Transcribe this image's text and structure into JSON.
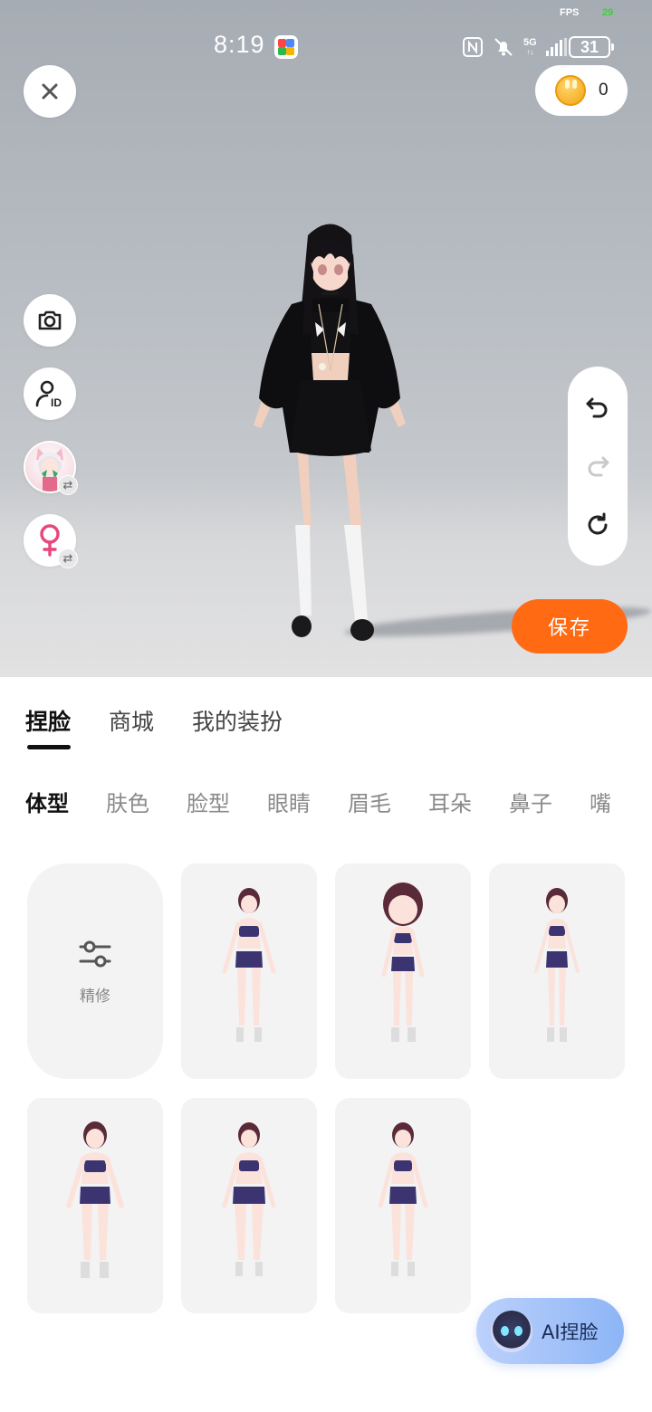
{
  "status_bar": {
    "time": "8:19",
    "fps_label": "FPS",
    "fps_value": "29",
    "network": "5G",
    "battery": "31"
  },
  "stage": {
    "coin_count": "0",
    "save_label": "保存",
    "icons": {
      "close": "close-icon",
      "coin": "coin-icon",
      "camera": "camera-icon",
      "id": "user-id-icon",
      "character_switch": "character-swap-icon",
      "gender": "female-icon",
      "undo": "undo-icon",
      "redo": "redo-icon",
      "reset": "reset-icon"
    }
  },
  "main_tabs": [
    {
      "label": "捏脸",
      "active": true
    },
    {
      "label": "商城",
      "active": false
    },
    {
      "label": "我的装扮",
      "active": false
    }
  ],
  "sub_tabs": [
    {
      "label": "体型",
      "active": true
    },
    {
      "label": "肤色",
      "active": false
    },
    {
      "label": "脸型",
      "active": false
    },
    {
      "label": "眼睛",
      "active": false
    },
    {
      "label": "眉毛",
      "active": false
    },
    {
      "label": "耳朵",
      "active": false
    },
    {
      "label": "鼻子",
      "active": false
    },
    {
      "label": "嘴",
      "active": false
    }
  ],
  "grid": {
    "refine_label": "精修",
    "body_type_options": 6
  },
  "ai_button": {
    "label": "AI捏脸"
  },
  "colors": {
    "accent_orange": "#ff6a13",
    "ai_button_blue": "#8db5f6",
    "outfit_purple": "#3b3470",
    "female_pink": "#e8467c"
  }
}
